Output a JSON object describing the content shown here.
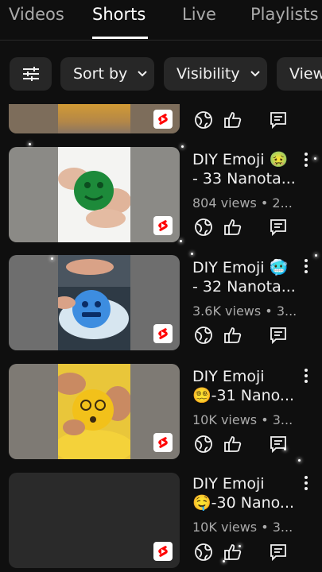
{
  "tabs": [
    {
      "label": "Videos",
      "active": false
    },
    {
      "label": "Shorts",
      "active": true
    },
    {
      "label": "Live",
      "active": false
    },
    {
      "label": "Playlists",
      "active": false
    }
  ],
  "filters": {
    "filter_icon": "sliders-icon",
    "sort_label": "Sort by",
    "visibility_label": "Visibility",
    "view_label": "View"
  },
  "videos": [
    {
      "title_line1": "",
      "title_line2": "",
      "meta": ""
    },
    {
      "title_line1": "DIY Emoji 🤢",
      "title_line2": "- 33 Nanota...",
      "meta": "804 views • 2..."
    },
    {
      "title_line1": "DIY Emoji 🥶",
      "title_line2": "- 32 Nanota...",
      "meta": "3.6K views • 3..."
    },
    {
      "title_line1": "DIY Emoji",
      "title_line2": "😵‍💫-31 Nano...",
      "meta": "10K views • 3..."
    },
    {
      "title_line1": "DIY Emoji",
      "title_line2": "🤤-30 Nano...",
      "meta": "10K views • 3..."
    }
  ],
  "colors": {
    "background": "#0f0f0f",
    "shorts_red": "#ff0000",
    "text_secondary": "#aaaaaa"
  }
}
